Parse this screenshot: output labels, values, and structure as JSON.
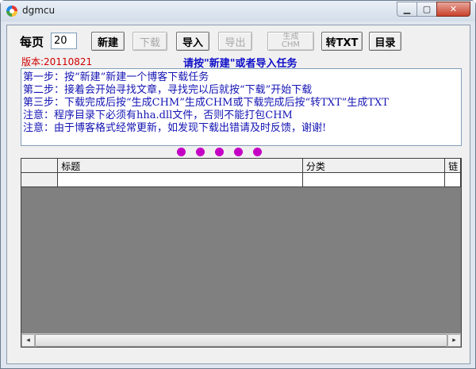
{
  "window": {
    "title": "dgmcu",
    "minimize_glyph": "▁",
    "maximize_glyph": "▢",
    "close_glyph": "✕"
  },
  "toolbar": {
    "per_page_label": "每页",
    "per_page_value": "20",
    "new_label": "新建",
    "download_label": "下载",
    "import_label": "导入",
    "export_label": "导出",
    "gen_chm_line1": "生成",
    "gen_chm_line2": "CHM",
    "to_txt_label": "转TXT",
    "catalog_label": "目录"
  },
  "version_text": "版本:20110821",
  "prompt_text": "请按\"新建\"或者导入任务",
  "instructions": [
    "第一步：按“新建”新建一个博客下载任务",
    "第二步：接着会开始寻找文章，寻找完以后就按“下载”开始下载",
    "第三步：下载完成后按“生成CHM”生成CHM或下载完成后按“转TXT”生成TXT",
    "注意：程序目录下必须有hha.dll文件，否则不能打包CHM",
    "注意：由于博客格式经常更新，如发现下载出错请及时反馈，谢谢!"
  ],
  "grid": {
    "columns": [
      "",
      "标题",
      "分类",
      "链"
    ],
    "rows": [
      [
        "",
        "",
        "",
        ""
      ]
    ]
  },
  "scrollbar": {
    "left_arrow": "◂",
    "right_arrow": "▸"
  },
  "colors": {
    "version": "#d00000",
    "prompt": "#1010c8",
    "instructions": "#1414b4",
    "dots": "#c400c4",
    "grid_background": "#808080"
  }
}
